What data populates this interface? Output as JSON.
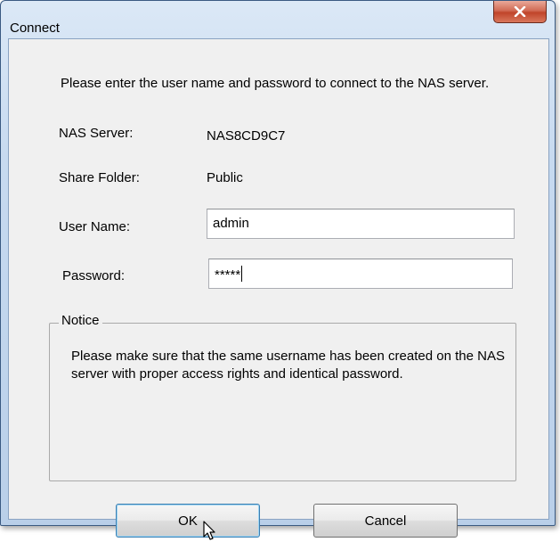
{
  "window": {
    "title": "Connect"
  },
  "prompt": "Please enter the user name and password to connect to the NAS server.",
  "fields": {
    "nas_server_label": "NAS Server:",
    "nas_server_value": "NAS8CD9C7",
    "share_folder_label": "Share Folder:",
    "share_folder_value": "Public",
    "user_name_label": "User Name:",
    "user_name_value": "admin",
    "password_label": "Password:",
    "password_value": "*****"
  },
  "notice": {
    "title": "Notice",
    "text": "Please make sure that the same username has been created on the NAS server with proper access rights and identical password."
  },
  "buttons": {
    "ok": "OK",
    "cancel": "Cancel"
  },
  "icons": {
    "close": "close-icon",
    "cursor": "mouse-pointer-icon"
  }
}
